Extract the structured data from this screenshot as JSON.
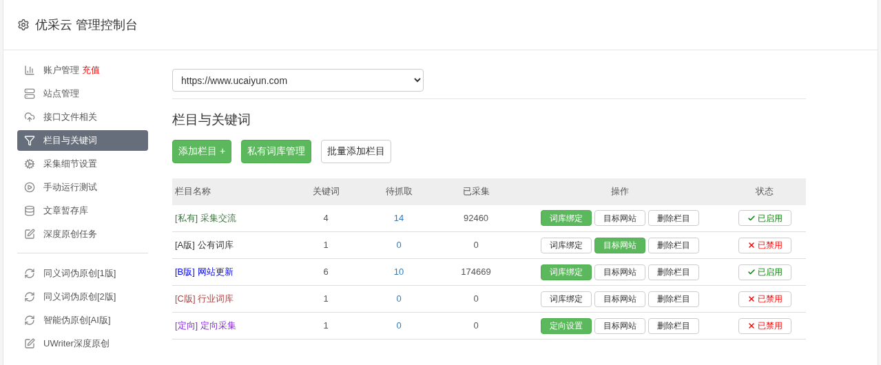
{
  "header": {
    "title": "优采云 管理控制台"
  },
  "sidebar": {
    "groups": [
      [
        {
          "label": "账户管理",
          "badge": "充值",
          "selected": false
        },
        {
          "label": "站点管理",
          "selected": false
        },
        {
          "label": "接口文件相关",
          "selected": false
        },
        {
          "label": "栏目与关键词",
          "selected": true
        },
        {
          "label": "采集细节设置",
          "selected": false
        },
        {
          "label": "手动运行测试",
          "selected": false
        },
        {
          "label": "文章暂存库",
          "selected": false
        },
        {
          "label": "深度原创任务",
          "selected": false
        }
      ],
      [
        {
          "label": "同义词伪原创[1版]",
          "selected": false
        },
        {
          "label": "同义词伪原创[2版]",
          "selected": false
        },
        {
          "label": "智能伪原创[AI版]",
          "selected": false
        },
        {
          "label": "UWriter深度原创",
          "selected": false
        }
      ]
    ]
  },
  "site_select": {
    "value": "https://www.ucaiyun.com"
  },
  "section_title": "栏目与关键词",
  "toolbar": [
    {
      "label": "添加栏目 +",
      "primary": true
    },
    {
      "label": "私有词库管理",
      "primary": true
    },
    {
      "label": "批量添加栏目",
      "primary": false
    }
  ],
  "table": {
    "columns": [
      "栏目名称",
      "关键词",
      "待抓取",
      "已采集",
      "操作",
      "状态"
    ],
    "rows": [
      {
        "tag": "[私有]",
        "name": "采集交流",
        "color": "#3c763d",
        "keywords": "4",
        "pending": "14",
        "collected": "92460",
        "actions": [
          {
            "label": "词库绑定",
            "primary": true
          },
          {
            "label": "目标网站",
            "primary": false
          },
          {
            "label": "删除栏目",
            "primary": false
          }
        ],
        "status": {
          "label": "已启用",
          "enabled": true
        }
      },
      {
        "tag": "[A版]",
        "name": "公有词库",
        "color": "#333333",
        "keywords": "1",
        "pending": "0",
        "collected": "0",
        "actions": [
          {
            "label": "词库绑定",
            "primary": false
          },
          {
            "label": "目标网站",
            "primary": true
          },
          {
            "label": "删除栏目",
            "primary": false
          }
        ],
        "status": {
          "label": "已禁用",
          "enabled": false
        }
      },
      {
        "tag": "[B版]",
        "name": "网站更新",
        "color": "#0000ff",
        "keywords": "6",
        "pending": "10",
        "collected": "174669",
        "actions": [
          {
            "label": "词库绑定",
            "primary": true
          },
          {
            "label": "目标网站",
            "primary": false
          },
          {
            "label": "删除栏目",
            "primary": false
          }
        ],
        "status": {
          "label": "已启用",
          "enabled": true
        }
      },
      {
        "tag": "[C版]",
        "name": "行业词库",
        "color": "#a94442",
        "keywords": "1",
        "pending": "0",
        "collected": "0",
        "actions": [
          {
            "label": "词库绑定",
            "primary": false
          },
          {
            "label": "目标网站",
            "primary": false
          },
          {
            "label": "删除栏目",
            "primary": false
          }
        ],
        "status": {
          "label": "已禁用",
          "enabled": false
        }
      },
      {
        "tag": "[定向]",
        "name": "定向采集",
        "color": "#8a2be2",
        "keywords": "1",
        "pending": "0",
        "collected": "0",
        "actions": [
          {
            "label": "定向设置",
            "primary": true
          },
          {
            "label": "目标网站",
            "primary": false
          },
          {
            "label": "删除栏目",
            "primary": false
          }
        ],
        "status": {
          "label": "已禁用",
          "enabled": false
        }
      }
    ]
  }
}
